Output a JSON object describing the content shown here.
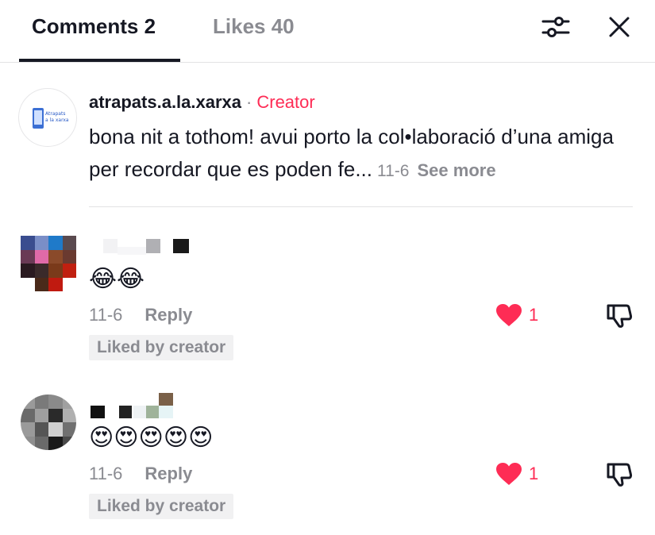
{
  "header": {
    "tabs": [
      {
        "label": "Comments 2",
        "active": true
      },
      {
        "label": "Likes 40",
        "active": false
      }
    ],
    "filter_icon": "sliders-icon",
    "close_icon": "close-icon"
  },
  "creator_post": {
    "avatar_text": "Atrapats a la xarxa",
    "username": "atrapats.a.la.xarxa",
    "separator": "·",
    "badge": "Creator",
    "text": "bona nit a tothom! avui porto la col•laboració d’una amiga per recordar que es poden fe...",
    "date": "11-6",
    "see_more": "See more"
  },
  "comments": [
    {
      "emojis": "😂😂",
      "date": "11-6",
      "reply_label": "Reply",
      "like_count": "1",
      "liked_badge": "Liked by creator"
    },
    {
      "emojis": "😍😍😍😍😍",
      "date": "11-6",
      "reply_label": "Reply",
      "like_count": "1",
      "liked_badge": "Liked by creator"
    }
  ],
  "colors": {
    "accent": "#fe2c55",
    "text": "#161823",
    "secondary": "#8a8b91",
    "badge_bg": "#f1f1f2"
  }
}
